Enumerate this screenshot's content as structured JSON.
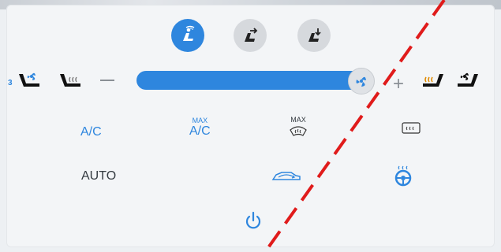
{
  "airflow_modes": [
    {
      "name": "windshield-and-face-airflow",
      "active": true
    },
    {
      "name": "face-airflow",
      "active": false
    },
    {
      "name": "feet-airflow",
      "active": false
    }
  ],
  "fan": {
    "speed_indicator": "3",
    "level": 0.95
  },
  "buttons": {
    "ac": "A/C",
    "max_ac_top": "MAX",
    "max_ac_bottom": "A/C",
    "max_defrost_top": "MAX",
    "auto": "AUTO"
  },
  "colors": {
    "accent": "#2e86de",
    "dark": "#333a40",
    "annotation": "#e01b1b"
  }
}
